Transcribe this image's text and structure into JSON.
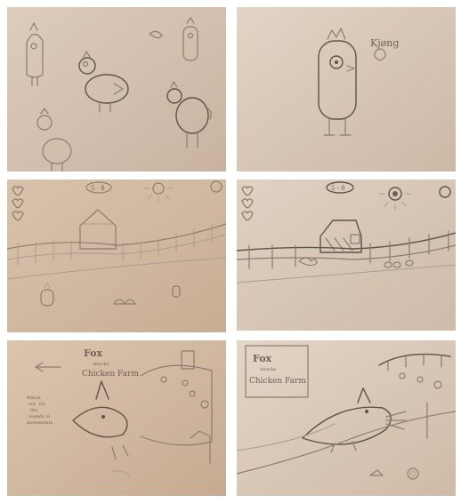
{
  "colors": {
    "paper_warm": "#d9c8b8",
    "paper_light": "#e4d8cc",
    "paper_shadow": "#c4ad98",
    "pencil": "#7a6e62"
  },
  "photos": [
    {
      "name": "chicken-character-sketches"
    },
    {
      "name": "chicken-character-closeup",
      "signature": "Kjøng"
    },
    {
      "name": "farm-level-sketch-light",
      "score": "5 - 8"
    },
    {
      "name": "farm-level-sketch-dark",
      "score": "5 - 8"
    },
    {
      "name": "fox-attack-sketch-a",
      "title_word": "Fox",
      "title_sub": "attacks",
      "title_farm": "Chicken Farm",
      "note_lines": [
        "Watch",
        "out",
        "for",
        "the",
        "sounds",
        "&",
        "movements"
      ]
    },
    {
      "name": "fox-attack-sketch-b",
      "title_word": "Fox",
      "title_sub": "attacks",
      "title_farm": "Chicken Farm"
    }
  ]
}
